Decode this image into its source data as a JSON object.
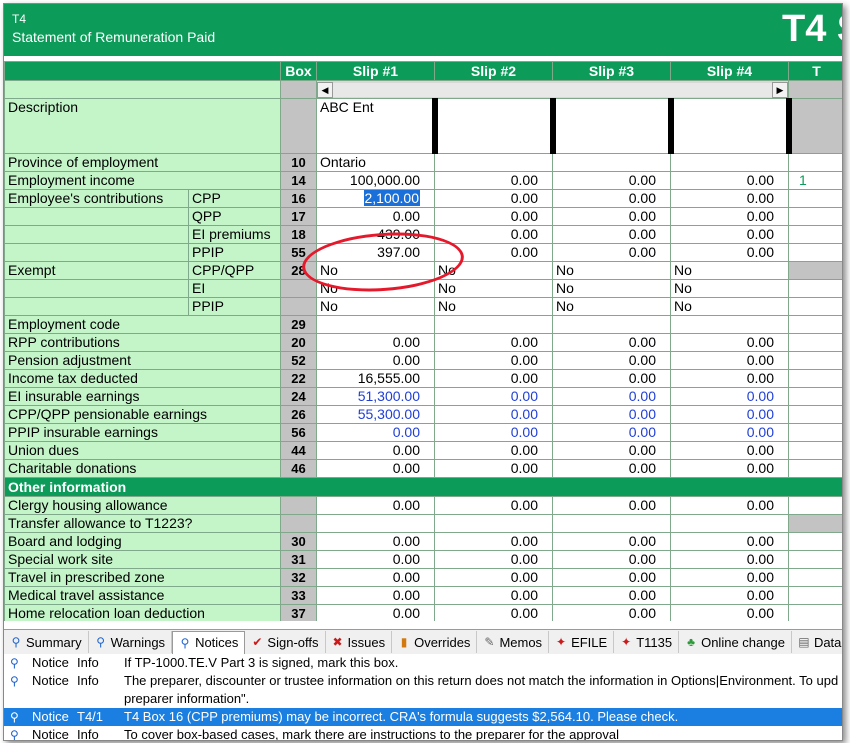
{
  "header": {
    "form_code": "T4",
    "form_title": "Statement of Remuneration Paid",
    "big_title": "T4 S"
  },
  "columns": {
    "box": "Box",
    "slips": [
      "Slip #1",
      "Slip #2",
      "Slip #3",
      "Slip #4"
    ],
    "extra": "T"
  },
  "description": {
    "label": "Description",
    "slip1": "ABC Ent"
  },
  "rows": [
    {
      "label": "Province of employment",
      "box": "10",
      "values": [
        "Ontario",
        "",
        "",
        ""
      ]
    },
    {
      "label": "Employment income",
      "box": "14",
      "values": [
        "100,000.00",
        "0.00",
        "0.00",
        "0.00"
      ],
      "extra": "1"
    },
    {
      "group": "Employee's contributions",
      "label": "CPP",
      "box": "16",
      "values": [
        "2,100.00",
        "0.00",
        "0.00",
        "0.00"
      ]
    },
    {
      "label": "QPP",
      "box": "17",
      "values": [
        "0.00",
        "0.00",
        "0.00",
        "0.00"
      ]
    },
    {
      "label": "EI premiums",
      "box": "18",
      "values": [
        "439.00",
        "0.00",
        "0.00",
        "0.00"
      ]
    },
    {
      "label": "PPIP",
      "box": "55",
      "values": [
        "397.00",
        "0.00",
        "0.00",
        "0.00"
      ]
    },
    {
      "group": "Exempt",
      "label": "CPP/QPP",
      "box": "28",
      "values": [
        "No",
        "No",
        "No",
        "No"
      ]
    },
    {
      "label": "EI",
      "box": "",
      "values": [
        "No",
        "No",
        "No",
        "No"
      ]
    },
    {
      "label": "PPIP",
      "box": "",
      "values": [
        "No",
        "No",
        "No",
        "No"
      ]
    },
    {
      "label": "Employment code",
      "box": "29",
      "values": [
        "",
        "",
        "",
        ""
      ]
    },
    {
      "label": "RPP contributions",
      "box": "20",
      "values": [
        "0.00",
        "0.00",
        "0.00",
        "0.00"
      ]
    },
    {
      "label": "Pension adjustment",
      "box": "52",
      "values": [
        "0.00",
        "0.00",
        "0.00",
        "0.00"
      ]
    },
    {
      "label": "Income tax deducted",
      "box": "22",
      "values": [
        "16,555.00",
        "0.00",
        "0.00",
        "0.00"
      ]
    },
    {
      "label": "EI insurable earnings",
      "box": "24",
      "values": [
        "51,300.00",
        "0.00",
        "0.00",
        "0.00"
      ]
    },
    {
      "label": "CPP/QPP pensionable earnings",
      "box": "26",
      "values": [
        "55,300.00",
        "0.00",
        "0.00",
        "0.00"
      ]
    },
    {
      "label": "PPIP insurable earnings",
      "box": "56",
      "values": [
        "0.00",
        "0.00",
        "0.00",
        "0.00"
      ]
    },
    {
      "label": "Union dues",
      "box": "44",
      "values": [
        "0.00",
        "0.00",
        "0.00",
        "0.00"
      ]
    },
    {
      "label": "Charitable donations",
      "box": "46",
      "values": [
        "0.00",
        "0.00",
        "0.00",
        "0.00"
      ]
    }
  ],
  "other_section": {
    "title": "Other information"
  },
  "other_rows": [
    {
      "label": "Clergy housing allowance",
      "box": "",
      "values": [
        "0.00",
        "0.00",
        "0.00",
        "0.00"
      ]
    },
    {
      "label": "Transfer allowance to T1223?",
      "box": "",
      "values": [
        "",
        "",
        "",
        ""
      ]
    },
    {
      "label": "Board and lodging",
      "box": "30",
      "values": [
        "0.00",
        "0.00",
        "0.00",
        "0.00"
      ]
    },
    {
      "label": "Special work site",
      "box": "31",
      "values": [
        "0.00",
        "0.00",
        "0.00",
        "0.00"
      ]
    },
    {
      "label": "Travel in prescribed zone",
      "box": "32",
      "values": [
        "0.00",
        "0.00",
        "0.00",
        "0.00"
      ]
    },
    {
      "label": "Medical travel assistance",
      "box": "33",
      "values": [
        "0.00",
        "0.00",
        "0.00",
        "0.00"
      ]
    },
    {
      "label": "Home relocation loan deduction",
      "box": "37",
      "values": [
        "0.00",
        "0.00",
        "0.00",
        "0.00"
      ]
    }
  ],
  "tabs": [
    {
      "label": "Summary",
      "icon": "magnifier-icon"
    },
    {
      "label": "Warnings",
      "icon": "magnifier-icon"
    },
    {
      "label": "Notices",
      "icon": "magnifier-icon",
      "active": true
    },
    {
      "label": "Sign-offs",
      "icon": "checkmark-icon"
    },
    {
      "label": "Issues",
      "icon": "x-icon"
    },
    {
      "label": "Overrides",
      "icon": "lock-icon"
    },
    {
      "label": "Memos",
      "icon": "memo-icon"
    },
    {
      "label": "EFILE",
      "icon": "maple-leaf-icon"
    },
    {
      "label": "T1135",
      "icon": "maple-leaf-icon"
    },
    {
      "label": "Online change",
      "icon": "tree-icon"
    },
    {
      "label": "Data In",
      "icon": "data-icon"
    }
  ],
  "notices": [
    {
      "type": "Notice",
      "ref": "Info",
      "text": "If TP-1000.TE.V Part 3 is signed, mark this box."
    },
    {
      "type": "Notice",
      "ref": "Info",
      "text": "The preparer, discounter or trustee information on this return does not match the information in Options|Environment. To upd"
    },
    {
      "type": "",
      "ref": "",
      "text": "preparer information\"."
    },
    {
      "type": "Notice",
      "ref": "T4/1",
      "text": "T4 Box 16 (CPP premiums) may be incorrect. CRA's formula suggests $2,564.10. Please check.",
      "selected": true
    },
    {
      "type": "Notice",
      "ref": "Info",
      "text": "To cover box-based cases, mark there are instructions to the preparer for the approval"
    }
  ]
}
